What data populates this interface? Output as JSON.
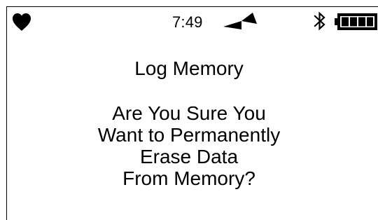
{
  "status_bar": {
    "time": "7:49",
    "icons": {
      "left": "heart-icon",
      "center_right": "signal-icon",
      "right_1": "bluetooth-icon",
      "right_2": "battery-icon"
    }
  },
  "dialog": {
    "title": "Log Memory",
    "message_lines": [
      "Are You Sure You",
      "Want to Permanently",
      "Erase Data",
      "From Memory?"
    ]
  },
  "colors": {
    "background": "#ffffff",
    "foreground": "#000000"
  }
}
